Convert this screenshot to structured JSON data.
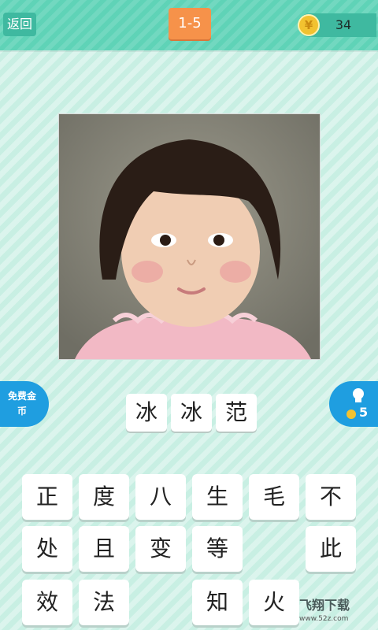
{
  "header": {
    "back_label": "返回",
    "level": "1-5",
    "coins": "34",
    "coin_symbol": "¥"
  },
  "puzzle": {
    "image_icon": "child-portrait-photo",
    "answer": [
      "冰",
      "冰",
      "范"
    ]
  },
  "side": {
    "free_coins_label": "免费金币",
    "hint_count": "5"
  },
  "keyboard": [
    {
      "row": 1,
      "col": 1,
      "ch": "正"
    },
    {
      "row": 1,
      "col": 2,
      "ch": "度"
    },
    {
      "row": 1,
      "col": 3,
      "ch": "八"
    },
    {
      "row": 1,
      "col": 4,
      "ch": "生"
    },
    {
      "row": 1,
      "col": 5,
      "ch": "毛"
    },
    {
      "row": 1,
      "col": 6,
      "ch": "不"
    },
    {
      "row": 2,
      "col": 1,
      "ch": "处"
    },
    {
      "row": 2,
      "col": 2,
      "ch": "且"
    },
    {
      "row": 2,
      "col": 3,
      "ch": "变"
    },
    {
      "row": 2,
      "col": 4,
      "ch": "等"
    },
    {
      "row": 2,
      "col": 6,
      "ch": "此"
    },
    {
      "row": 3,
      "col": 1,
      "ch": "效"
    },
    {
      "row": 3,
      "col": 2,
      "ch": "法"
    },
    {
      "row": 3,
      "col": 4,
      "ch": "知"
    },
    {
      "row": 3,
      "col": 5,
      "ch": "火"
    }
  ],
  "watermark": {
    "brand": "飞翔下载",
    "url": "www.52z.com"
  },
  "colors": {
    "accent": "#5fd3b7",
    "level_tag": "#f6924a",
    "side_buttons": "#1f9ee0",
    "coin": "#f2c230"
  }
}
